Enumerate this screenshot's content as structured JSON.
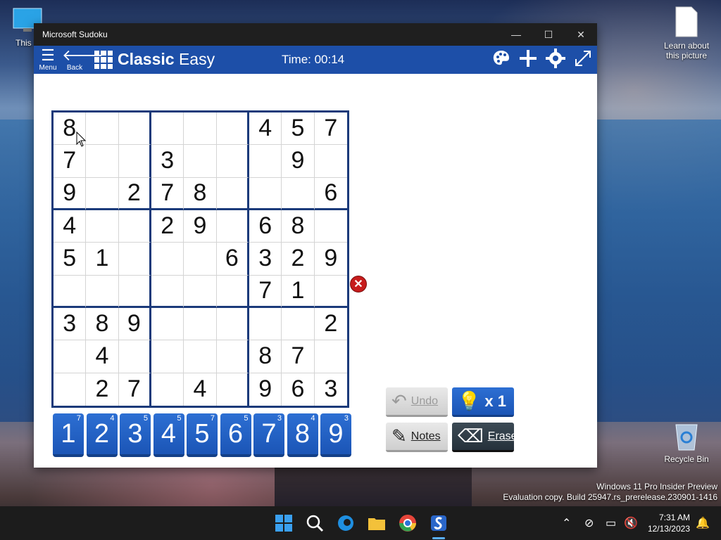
{
  "desktop": {
    "this_pc_label": "This P",
    "learn_label": "Learn about this picture",
    "recycle_label": "Recycle Bin",
    "watermark_line1": "Windows 11 Pro Insider Preview",
    "watermark_line2": "Evaluation copy. Build 25947.rs_prerelease.230901-1416"
  },
  "window": {
    "title": "Microsoft Sudoku",
    "minimize_glyph": "—",
    "maximize_glyph": "☐",
    "close_glyph": "✕"
  },
  "appbar": {
    "menu_label": "Menu",
    "back_label": "Back",
    "mode_bold": "Classic",
    "mode_level": "Easy",
    "timer": "Time: 00:14",
    "icons": [
      "palette-icon",
      "plus-icon",
      "gear-icon",
      "expand-icon"
    ]
  },
  "board": {
    "cells": [
      [
        "8",
        "",
        "",
        "",
        "",
        "",
        "4",
        "5",
        "7"
      ],
      [
        "7",
        "",
        "",
        "3",
        "",
        "",
        "",
        "9",
        ""
      ],
      [
        "9",
        "",
        "2",
        "7",
        "8",
        "",
        "",
        "",
        "6"
      ],
      [
        "4",
        "",
        "",
        "2",
        "9",
        "",
        "6",
        "8",
        ""
      ],
      [
        "5",
        "1",
        "",
        "",
        "",
        "6",
        "3",
        "2",
        "9"
      ],
      [
        "",
        "",
        "",
        "",
        "",
        "",
        "7",
        "1",
        ""
      ],
      [
        "3",
        "8",
        "9",
        "",
        "",
        "",
        "",
        "",
        "2"
      ],
      [
        "",
        "4",
        "",
        "",
        "",
        "",
        "8",
        "7",
        ""
      ],
      [
        "",
        "2",
        "7",
        "",
        "4",
        "",
        "9",
        "6",
        "3"
      ]
    ]
  },
  "numpad": [
    {
      "digit": "1",
      "count": "7"
    },
    {
      "digit": "2",
      "count": "4"
    },
    {
      "digit": "3",
      "count": "5"
    },
    {
      "digit": "4",
      "count": "5"
    },
    {
      "digit": "5",
      "count": "7"
    },
    {
      "digit": "6",
      "count": "5"
    },
    {
      "digit": "7",
      "count": "3"
    },
    {
      "digit": "8",
      "count": "4"
    },
    {
      "digit": "9",
      "count": "3"
    }
  ],
  "actions": {
    "undo": "Undo",
    "hint": "x 1",
    "notes": "Notes",
    "erase": "Erase"
  },
  "taskbar": {
    "time": "7:31 AM",
    "date": "12/13/2023"
  }
}
